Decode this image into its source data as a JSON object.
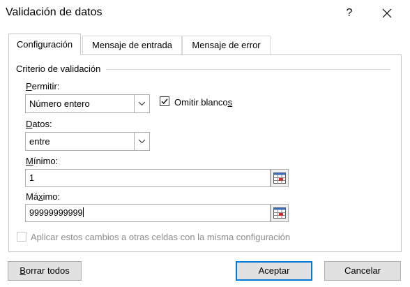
{
  "window": {
    "title": "Validación de datos",
    "help_label": "?",
    "close_icon": "close-icon"
  },
  "tabs": [
    {
      "label": "Configuración",
      "active": true
    },
    {
      "label": "Mensaje de entrada",
      "active": false
    },
    {
      "label": "Mensaje de error",
      "active": false
    }
  ],
  "criteria": {
    "group_label": "Criterio de validación",
    "allow": {
      "label_prefix": "",
      "label_hotkey": "P",
      "label_rest": "ermitir:",
      "value": "Número entero",
      "dropdown_icon": "chevron-down-icon"
    },
    "ignore_blank": {
      "label_main": "Omitir blanco",
      "label_hotkey": "s",
      "checked": true
    },
    "data": {
      "label_hotkey": "D",
      "label_rest": "atos:",
      "value": "entre",
      "dropdown_icon": "chevron-down-icon"
    },
    "minimum": {
      "label_hotkey": "M",
      "label_rest": "ínimo:",
      "value": "1",
      "ref_icon": "range-select-icon"
    },
    "maximum": {
      "label_prefix": "Má",
      "label_hotkey": "x",
      "label_rest": "imo:",
      "value": "99999999999",
      "ref_icon": "range-select-icon"
    },
    "apply_all": {
      "label": "Aplicar estos cambios a otras celdas con la misma configuración",
      "checked": false,
      "enabled": false
    }
  },
  "footer": {
    "clear_hotkey": "B",
    "clear_rest": "orrar todos",
    "ok_label": "Aceptar",
    "cancel_label": "Cancelar"
  },
  "colors": {
    "accent": "#0078d7",
    "button_bg": "#e1e1e1",
    "border": "#adadad",
    "disabled_text": "#8c8c8c"
  }
}
